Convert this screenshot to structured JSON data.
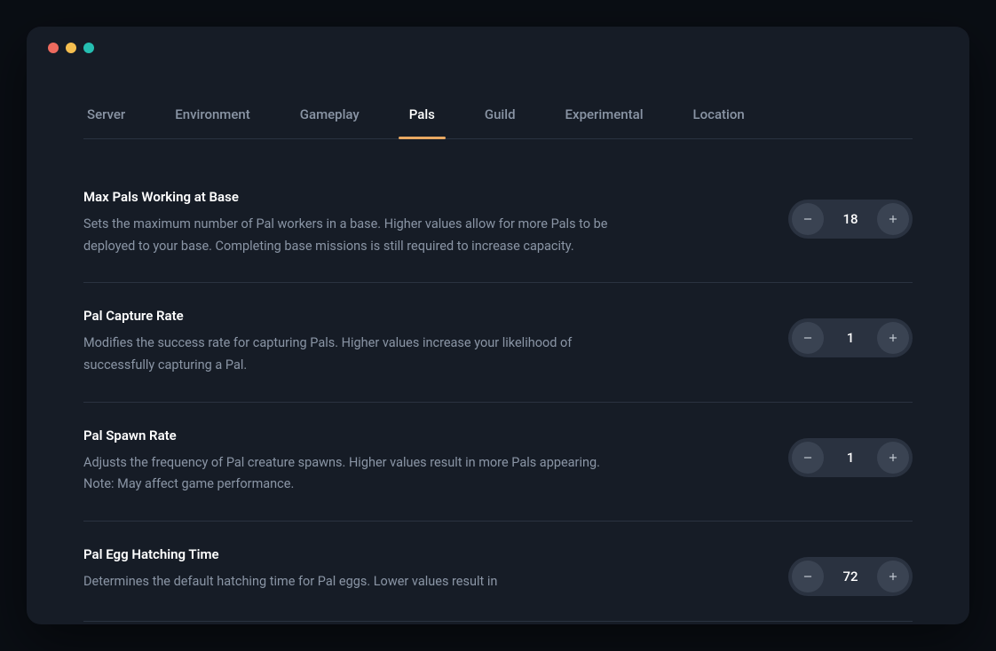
{
  "tabs": [
    {
      "id": "server",
      "label": "Server",
      "active": false
    },
    {
      "id": "environment",
      "label": "Environment",
      "active": false
    },
    {
      "id": "gameplay",
      "label": "Gameplay",
      "active": false
    },
    {
      "id": "pals",
      "label": "Pals",
      "active": true
    },
    {
      "id": "guild",
      "label": "Guild",
      "active": false
    },
    {
      "id": "experimental",
      "label": "Experimental",
      "active": false
    },
    {
      "id": "location",
      "label": "Location",
      "active": false
    }
  ],
  "settings": [
    {
      "id": "max-pals-working",
      "title": "Max Pals Working at Base",
      "description": "Sets the maximum number of Pal workers in a base. Higher values allow for more Pals to be deployed to your base. Completing base missions is still required to increase capacity.",
      "value": "18"
    },
    {
      "id": "pal-capture-rate",
      "title": "Pal Capture Rate",
      "description": "Modifies the success rate for capturing Pals. Higher values increase your likelihood of successfully capturing a Pal.",
      "value": "1"
    },
    {
      "id": "pal-spawn-rate",
      "title": "Pal Spawn Rate",
      "description": "Adjusts the frequency of Pal creature spawns. Higher values result in more Pals appearing. Note: May affect game performance.",
      "value": "1"
    },
    {
      "id": "pal-egg-hatching-time",
      "title": "Pal Egg Hatching Time",
      "description": "Determines the default hatching time for Pal eggs. Lower values result in",
      "value": "72"
    }
  ],
  "colors": {
    "accent": "#e8a862",
    "background": "#161c26",
    "traffic_red": "#ed6a5e",
    "traffic_yellow": "#f5be4f",
    "traffic_green": "#25beb1"
  }
}
